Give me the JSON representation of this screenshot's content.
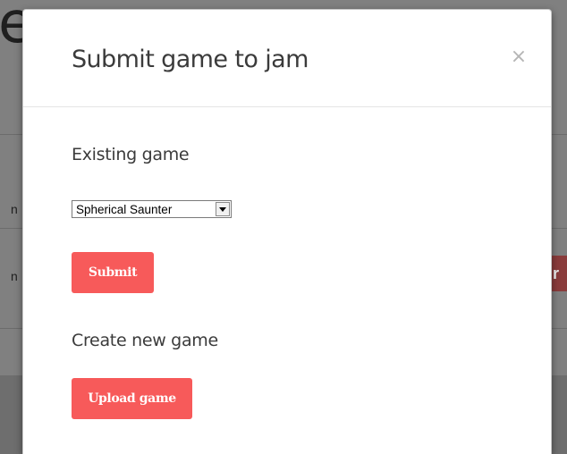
{
  "background": {
    "title_fragment": "e",
    "left_fragments": [
      "n",
      "n"
    ],
    "right_button_fragment": "r"
  },
  "modal": {
    "title": "Submit game to jam",
    "close_symbol": "×",
    "existing": {
      "heading": "Existing game",
      "selected_game": "Spherical Saunter",
      "submit_label": "Submit"
    },
    "create": {
      "heading": "Create new game",
      "upload_label": "Upload game"
    }
  },
  "colors": {
    "button": "#f75a5a",
    "overlay": "#808080",
    "heading_text": "#3b3b3b"
  },
  "icons": {
    "close": "close-icon",
    "select_arrow": "chevron-down-icon"
  }
}
